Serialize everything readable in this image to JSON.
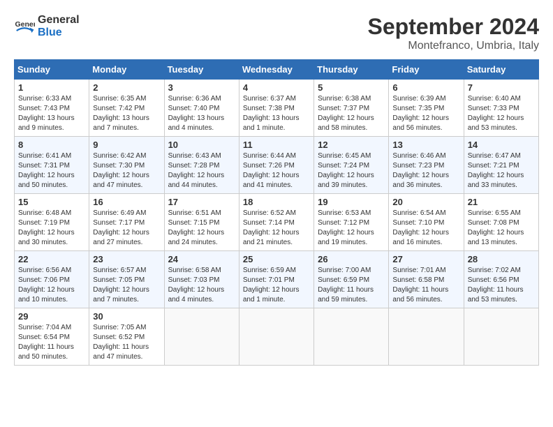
{
  "logo": {
    "text_general": "General",
    "text_blue": "Blue"
  },
  "header": {
    "month": "September 2024",
    "location": "Montefranco, Umbria, Italy"
  },
  "columns": [
    "Sunday",
    "Monday",
    "Tuesday",
    "Wednesday",
    "Thursday",
    "Friday",
    "Saturday"
  ],
  "weeks": [
    [
      {
        "day": "1",
        "sunrise": "6:33 AM",
        "sunset": "7:43 PM",
        "daylight": "13 hours and 9 minutes."
      },
      {
        "day": "2",
        "sunrise": "6:35 AM",
        "sunset": "7:42 PM",
        "daylight": "13 hours and 7 minutes."
      },
      {
        "day": "3",
        "sunrise": "6:36 AM",
        "sunset": "7:40 PM",
        "daylight": "13 hours and 4 minutes."
      },
      {
        "day": "4",
        "sunrise": "6:37 AM",
        "sunset": "7:38 PM",
        "daylight": "13 hours and 1 minute."
      },
      {
        "day": "5",
        "sunrise": "6:38 AM",
        "sunset": "7:37 PM",
        "daylight": "12 hours and 58 minutes."
      },
      {
        "day": "6",
        "sunrise": "6:39 AM",
        "sunset": "7:35 PM",
        "daylight": "12 hours and 56 minutes."
      },
      {
        "day": "7",
        "sunrise": "6:40 AM",
        "sunset": "7:33 PM",
        "daylight": "12 hours and 53 minutes."
      }
    ],
    [
      {
        "day": "8",
        "sunrise": "6:41 AM",
        "sunset": "7:31 PM",
        "daylight": "12 hours and 50 minutes."
      },
      {
        "day": "9",
        "sunrise": "6:42 AM",
        "sunset": "7:30 PM",
        "daylight": "12 hours and 47 minutes."
      },
      {
        "day": "10",
        "sunrise": "6:43 AM",
        "sunset": "7:28 PM",
        "daylight": "12 hours and 44 minutes."
      },
      {
        "day": "11",
        "sunrise": "6:44 AM",
        "sunset": "7:26 PM",
        "daylight": "12 hours and 41 minutes."
      },
      {
        "day": "12",
        "sunrise": "6:45 AM",
        "sunset": "7:24 PM",
        "daylight": "12 hours and 39 minutes."
      },
      {
        "day": "13",
        "sunrise": "6:46 AM",
        "sunset": "7:23 PM",
        "daylight": "12 hours and 36 minutes."
      },
      {
        "day": "14",
        "sunrise": "6:47 AM",
        "sunset": "7:21 PM",
        "daylight": "12 hours and 33 minutes."
      }
    ],
    [
      {
        "day": "15",
        "sunrise": "6:48 AM",
        "sunset": "7:19 PM",
        "daylight": "12 hours and 30 minutes."
      },
      {
        "day": "16",
        "sunrise": "6:49 AM",
        "sunset": "7:17 PM",
        "daylight": "12 hours and 27 minutes."
      },
      {
        "day": "17",
        "sunrise": "6:51 AM",
        "sunset": "7:15 PM",
        "daylight": "12 hours and 24 minutes."
      },
      {
        "day": "18",
        "sunrise": "6:52 AM",
        "sunset": "7:14 PM",
        "daylight": "12 hours and 21 minutes."
      },
      {
        "day": "19",
        "sunrise": "6:53 AM",
        "sunset": "7:12 PM",
        "daylight": "12 hours and 19 minutes."
      },
      {
        "day": "20",
        "sunrise": "6:54 AM",
        "sunset": "7:10 PM",
        "daylight": "12 hours and 16 minutes."
      },
      {
        "day": "21",
        "sunrise": "6:55 AM",
        "sunset": "7:08 PM",
        "daylight": "12 hours and 13 minutes."
      }
    ],
    [
      {
        "day": "22",
        "sunrise": "6:56 AM",
        "sunset": "7:06 PM",
        "daylight": "12 hours and 10 minutes."
      },
      {
        "day": "23",
        "sunrise": "6:57 AM",
        "sunset": "7:05 PM",
        "daylight": "12 hours and 7 minutes."
      },
      {
        "day": "24",
        "sunrise": "6:58 AM",
        "sunset": "7:03 PM",
        "daylight": "12 hours and 4 minutes."
      },
      {
        "day": "25",
        "sunrise": "6:59 AM",
        "sunset": "7:01 PM",
        "daylight": "12 hours and 1 minute."
      },
      {
        "day": "26",
        "sunrise": "7:00 AM",
        "sunset": "6:59 PM",
        "daylight": "11 hours and 59 minutes."
      },
      {
        "day": "27",
        "sunrise": "7:01 AM",
        "sunset": "6:58 PM",
        "daylight": "11 hours and 56 minutes."
      },
      {
        "day": "28",
        "sunrise": "7:02 AM",
        "sunset": "6:56 PM",
        "daylight": "11 hours and 53 minutes."
      }
    ],
    [
      {
        "day": "29",
        "sunrise": "7:04 AM",
        "sunset": "6:54 PM",
        "daylight": "11 hours and 50 minutes."
      },
      {
        "day": "30",
        "sunrise": "7:05 AM",
        "sunset": "6:52 PM",
        "daylight": "11 hours and 47 minutes."
      },
      null,
      null,
      null,
      null,
      null
    ]
  ]
}
